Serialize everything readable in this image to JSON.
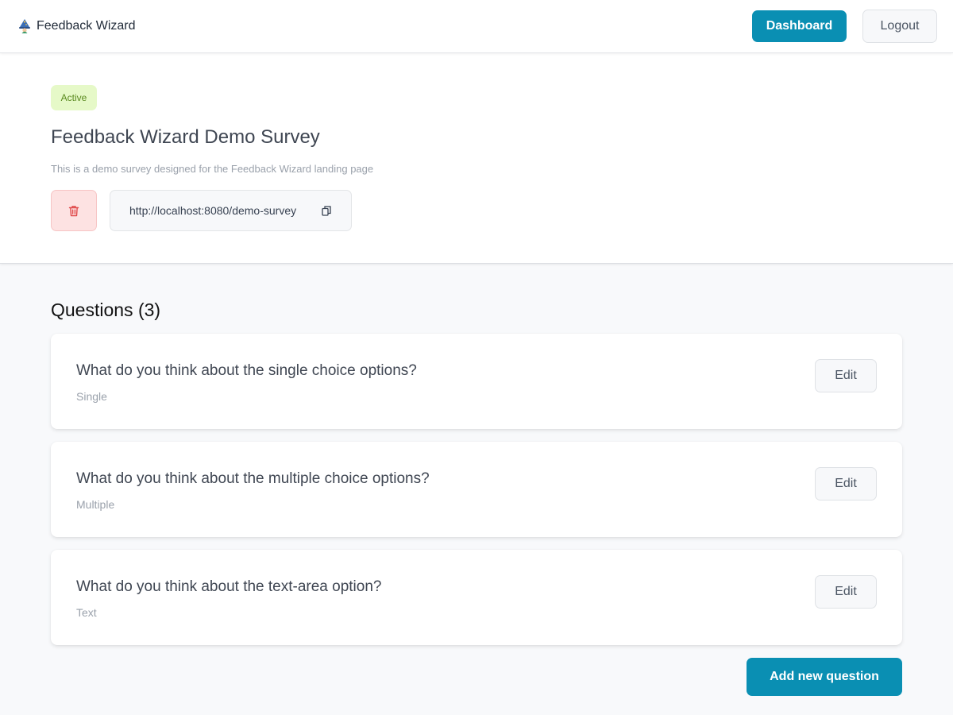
{
  "navbar": {
    "brand_name": "Feedback Wizard",
    "logo_icon": "wizard-hat-icon",
    "dashboard_label": "Dashboard",
    "logout_label": "Logout"
  },
  "survey": {
    "status": "Active",
    "title": "Feedback Wizard Demo Survey",
    "description": "This is a demo survey designed for the Feedback Wizard landing page",
    "link": "http://localhost:8080/demo-survey",
    "delete_icon": "trash-icon",
    "copy_icon": "copy-icon"
  },
  "questions": {
    "heading": "Questions (3)",
    "items": [
      {
        "title": "What do you think about the single choice options?",
        "type": "Single",
        "edit_label": "Edit"
      },
      {
        "title": "What do you think about the multiple choice options?",
        "type": "Multiple",
        "edit_label": "Edit"
      },
      {
        "title": "What do you think about the text-area option?",
        "type": "Text",
        "edit_label": "Edit"
      }
    ],
    "add_label": "Add new question"
  },
  "colors": {
    "primary": "#0a8fb3",
    "badge_bg": "#e6f9c8",
    "badge_text": "#5a8a1f",
    "delete_bg": "#fde2e2",
    "delete_icon": "#e0494a"
  }
}
